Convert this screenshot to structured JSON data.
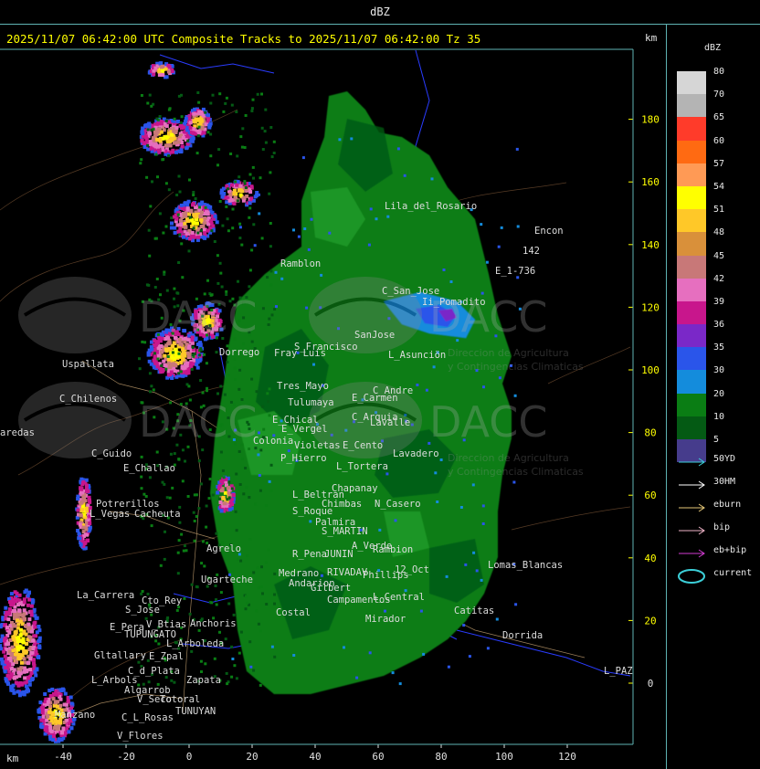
{
  "window": {
    "title": "dBZ"
  },
  "header": {
    "text": "2025/11/07 06:42:00 UTC Composite Tracks to 2025/11/07 06:42:00 Tz 35",
    "km_top": "km",
    "km_bottom": "km"
  },
  "legend": {
    "title": "dBZ",
    "scale": [
      {
        "label": "80",
        "color": "#d6d6d6"
      },
      {
        "label": "70",
        "color": "#b4b4b4"
      },
      {
        "label": "65",
        "color": "#ff3b2a"
      },
      {
        "label": "60",
        "color": "#ff6a12"
      },
      {
        "label": "57",
        "color": "#ff9a55"
      },
      {
        "label": "54",
        "color": "#ffff00"
      },
      {
        "label": "51",
        "color": "#ffc828"
      },
      {
        "label": "48",
        "color": "#d9903a"
      },
      {
        "label": "45",
        "color": "#c87878"
      },
      {
        "label": "42",
        "color": "#e66fbf"
      },
      {
        "label": "39",
        "color": "#c8168c"
      },
      {
        "label": "36",
        "color": "#7a28c8"
      },
      {
        "label": "35",
        "color": "#2a55ea"
      },
      {
        "label": "30",
        "color": "#148cdc"
      },
      {
        "label": "20",
        "color": "#0a7d14"
      },
      {
        "label": "10",
        "color": "#045a14"
      },
      {
        "label": "5",
        "color": "#463c8c"
      }
    ],
    "tracks": [
      {
        "label": "50YD",
        "color": "#3ccfd8",
        "type": "arrow"
      },
      {
        "label": "30HM",
        "color": "#ffffff",
        "type": "arrow"
      },
      {
        "label": "eburn",
        "color": "#e6c878",
        "type": "arrow"
      },
      {
        "label": "bip",
        "color": "#f0b4c8",
        "type": "arrow"
      },
      {
        "label": "eb+bip",
        "color": "#d23cd2",
        "type": "arrow"
      },
      {
        "label": "current",
        "color": "#3ccfd8",
        "type": "ellipse"
      }
    ]
  },
  "axes": {
    "x_ticks": [
      "-40",
      "-20",
      "0",
      "20",
      "40",
      "60",
      "80",
      "100",
      "120"
    ],
    "y_ticks": [
      "180",
      "160",
      "140",
      "120",
      "100",
      "80",
      "60",
      "40",
      "20",
      "0"
    ]
  },
  "places": [
    {
      "name": "Uspallata"
    },
    {
      "name": "C_Chilenos"
    },
    {
      "name": "aredas"
    },
    {
      "name": "C_Guido"
    },
    {
      "name": "E_Challao"
    },
    {
      "name": "Potrerillos"
    },
    {
      "name": "L_Vegas"
    },
    {
      "name": "Cacheuta"
    },
    {
      "name": "Agrelo"
    },
    {
      "name": "Ugarteche"
    },
    {
      "name": "La_Carrera"
    },
    {
      "name": "Cto_Rey"
    },
    {
      "name": "S_Jose"
    },
    {
      "name": "Anchoris"
    },
    {
      "name": "E_Pera"
    },
    {
      "name": "TUPUNGATO"
    },
    {
      "name": "V_Btias"
    },
    {
      "name": "L_Arboleda"
    },
    {
      "name": "Gltallary"
    },
    {
      "name": "E_Zpal"
    },
    {
      "name": "C_d_Plata"
    },
    {
      "name": "L_Arbols"
    },
    {
      "name": "Zapata"
    },
    {
      "name": "Algarrob"
    },
    {
      "name": "V_Seco"
    },
    {
      "name": "Totoral"
    },
    {
      "name": "TUNUYAN"
    },
    {
      "name": "C_L_Rosas"
    },
    {
      "name": "Manzano"
    },
    {
      "name": "V_Flores"
    },
    {
      "name": "Ramblon"
    },
    {
      "name": "S_Francisco"
    },
    {
      "name": "Tres_Mayo"
    },
    {
      "name": "Tulumaya"
    },
    {
      "name": "E_Carmen"
    },
    {
      "name": "C_Andre"
    },
    {
      "name": "E_Chical"
    },
    {
      "name": "E_Vergel"
    },
    {
      "name": "C_Arquia"
    },
    {
      "name": "Lavalle"
    },
    {
      "name": "Colonia"
    },
    {
      "name": "Violetas"
    },
    {
      "name": "E_Cento"
    },
    {
      "name": "P_Hierro"
    },
    {
      "name": "Lavadero"
    },
    {
      "name": "L_Tortera"
    },
    {
      "name": "L_Beltran"
    },
    {
      "name": "Chapanay"
    },
    {
      "name": "Chimbas"
    },
    {
      "name": "N_Casero"
    },
    {
      "name": "S_Roque"
    },
    {
      "name": "Palmira"
    },
    {
      "name": "S_MARTIN"
    },
    {
      "name": "A_Verde"
    },
    {
      "name": "Rambion"
    },
    {
      "name": "R_Pena"
    },
    {
      "name": "JUNIN"
    },
    {
      "name": "RIVADAV"
    },
    {
      "name": "Phillips"
    },
    {
      "name": "12_Oct"
    },
    {
      "name": "Medrano"
    },
    {
      "name": "Andarion"
    },
    {
      "name": "Gilbert"
    },
    {
      "name": "Campamentos"
    },
    {
      "name": "L_Central"
    },
    {
      "name": "Mirador"
    },
    {
      "name": "Lomas_Blancas"
    },
    {
      "name": "Catitas"
    },
    {
      "name": "Dorrida"
    },
    {
      "name": "L_PAZ"
    },
    {
      "name": "Lila_del_Rosario"
    },
    {
      "name": "Encon"
    },
    {
      "name": "142"
    },
    {
      "name": "E_1-736"
    },
    {
      "name": "C_San_Jose"
    },
    {
      "name": "Ii_Pomadito"
    },
    {
      "name": "SanJose"
    },
    {
      "name": "L_Asunciön"
    },
    {
      "name": "Dorrego"
    },
    {
      "name": "Fray Luis"
    },
    {
      "name": "Costal"
    }
  ],
  "watermarks": [
    {
      "text": "DACC"
    },
    {
      "text": "DACC"
    },
    {
      "text": "DACC"
    },
    {
      "text": "DACC"
    }
  ],
  "watermark_sub": [
    {
      "text": "Direccion de Agricultura"
    },
    {
      "text": "y Contingencias Climaticas"
    }
  ]
}
